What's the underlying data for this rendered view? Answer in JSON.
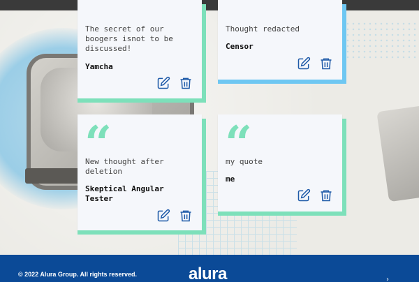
{
  "page": {
    "accent_green": "#7de0ba",
    "accent_blue": "#6ec7f2",
    "footer_color": "#0b4a97"
  },
  "quotes": [
    {
      "content": "The secret of our\nboogers isnot to be\ndiscussed!",
      "author": "Yamcha",
      "theme": "green"
    },
    {
      "content": "Thought redacted",
      "author": "Censor",
      "theme": "blue"
    },
    {
      "content": "New thought after\ndeletion",
      "author": "Skeptical Angular\nTester",
      "theme": "green"
    },
    {
      "content": "my quote",
      "author": "me",
      "theme": "green"
    }
  ],
  "icons": {
    "quote": "quote-icon",
    "edit": "edit-icon",
    "delete": "trash-icon"
  },
  "footer": {
    "copyright": "© 2022 Alura Group. All rights reserved.",
    "logo": "alura"
  }
}
